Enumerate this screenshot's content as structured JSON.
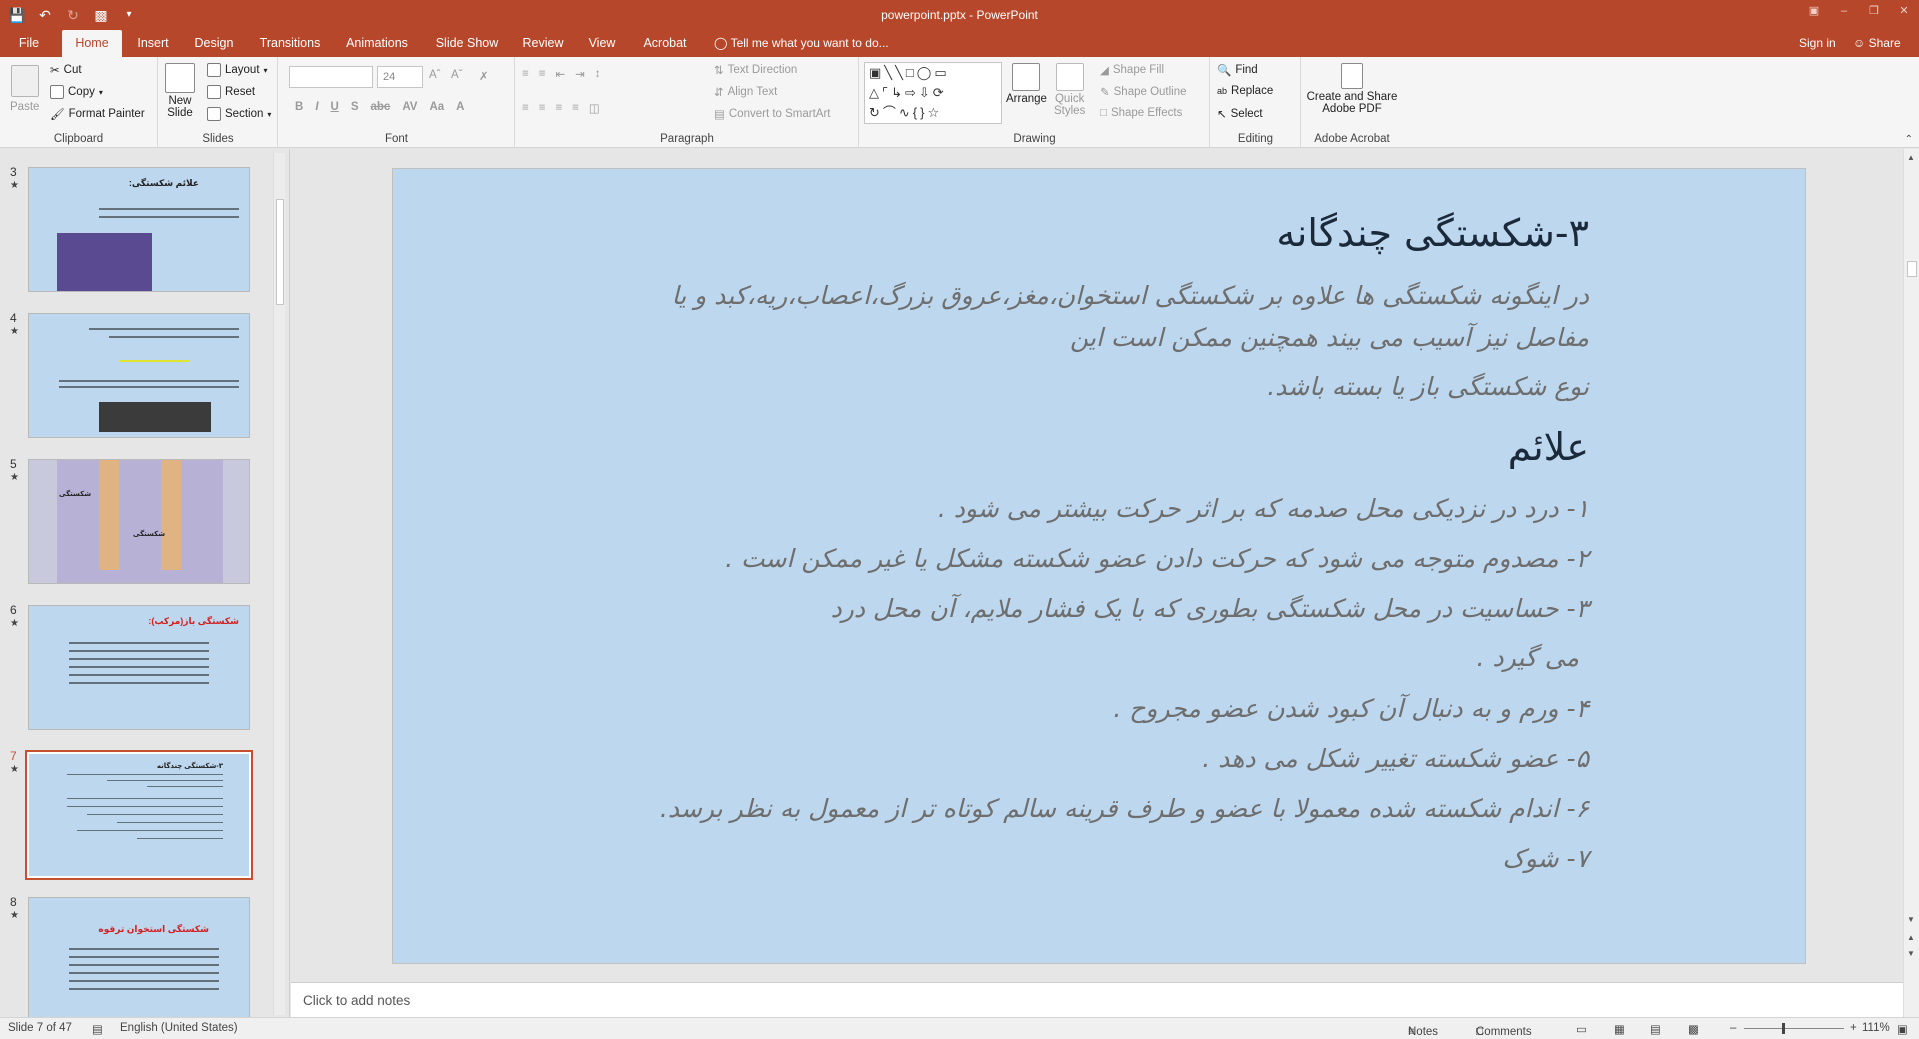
{
  "app": {
    "window_title": "powerpoint.pptx - PowerPoint",
    "sign_in": "Sign in",
    "share": "Share",
    "tell_me": "Tell me what you want to do..."
  },
  "tabs": [
    "File",
    "Home",
    "Insert",
    "Design",
    "Transitions",
    "Animations",
    "Slide Show",
    "Review",
    "View",
    "Acrobat"
  ],
  "ribbon": {
    "clipboard": {
      "label": "Clipboard",
      "paste": "Paste",
      "cut": "Cut",
      "copy": "Copy",
      "format_painter": "Format Painter"
    },
    "slides": {
      "label": "Slides",
      "new_slide_1": "New",
      "new_slide_2": "Slide",
      "layout": "Layout",
      "reset": "Reset",
      "section": "Section"
    },
    "font": {
      "label": "Font",
      "size": "24"
    },
    "paragraph": {
      "label": "Paragraph",
      "text_direction": "Text Direction",
      "align_text": "Align Text",
      "convert_smartart": "Convert to SmartArt"
    },
    "drawing": {
      "label": "Drawing",
      "arrange": "Arrange",
      "quick_1": "Quick",
      "quick_2": "Styles",
      "shape_fill": "Shape Fill",
      "shape_outline": "Shape Outline",
      "shape_effects": "Shape Effects"
    },
    "editing": {
      "label": "Editing",
      "find": "Find",
      "replace": "Replace",
      "select": "Select"
    },
    "acrobat": {
      "label": "Adobe Acrobat",
      "create_1": "Create and Share",
      "create_2": "Adobe PDF"
    }
  },
  "thumbnails": {
    "numbers": [
      "3",
      "4",
      "5",
      "6",
      "7",
      "8"
    ],
    "s3_title": "علائم شکستگی:",
    "s5_label_1": "شکستگی",
    "s5_label_2": "شکستگی",
    "s6_title": "شکستگی باز(مرکب):",
    "s7_title": "۳-شکستگی چندگانه",
    "s8_title": "شکستگی استخوان ترقوه"
  },
  "slide": {
    "title": "۳-شکستگی چندگانه",
    "intro_1": "در اینگونه شکستگی ها علاوه بر شکستگی استخوان،مغز،عروق بزرگ،اعصاب،ریه،کبد و یا",
    "intro_2": "مفاصل نیز آسیب می بیند همچنین ممکن است این",
    "intro_3": "نوع شکستگی باز یا بسته باشد.",
    "subheading": "علائم",
    "s1": "۱- درد در نزدیکی محل صدمه که بر اثر حرکت بیشتر می شود .",
    "s2": "۲- مصدوم متوجه می شود که حرکت دادن عضو شکسته مشکل یا غیر ممکن است .",
    "s3a": "۳- حساسیت در محل شکستگی بطوری که با یک فشار ملایم، آن محل درد",
    "s3b": "می گیرد .",
    "s4": "۴- ورم و به دنبال آن کبود شدن عضو مجروح .",
    "s5": "۵- عضو شکسته تغییر شکل می دهد .",
    "s6": "۶- اندام شکسته شده معمولا با عضو و طرف قرینه سالم کوتاه تر از معمول به نظر برسد.",
    "s7": "۷- شوک"
  },
  "notes": {
    "placeholder": "Click to add notes"
  },
  "status": {
    "slide": "Slide 7 of 47",
    "language": "English (United States)",
    "notes": "Notes",
    "comments": "Comments",
    "zoom": "111%"
  },
  "colors": {
    "accent": "#b7472a",
    "slide_bg": "#bdd7ee"
  }
}
